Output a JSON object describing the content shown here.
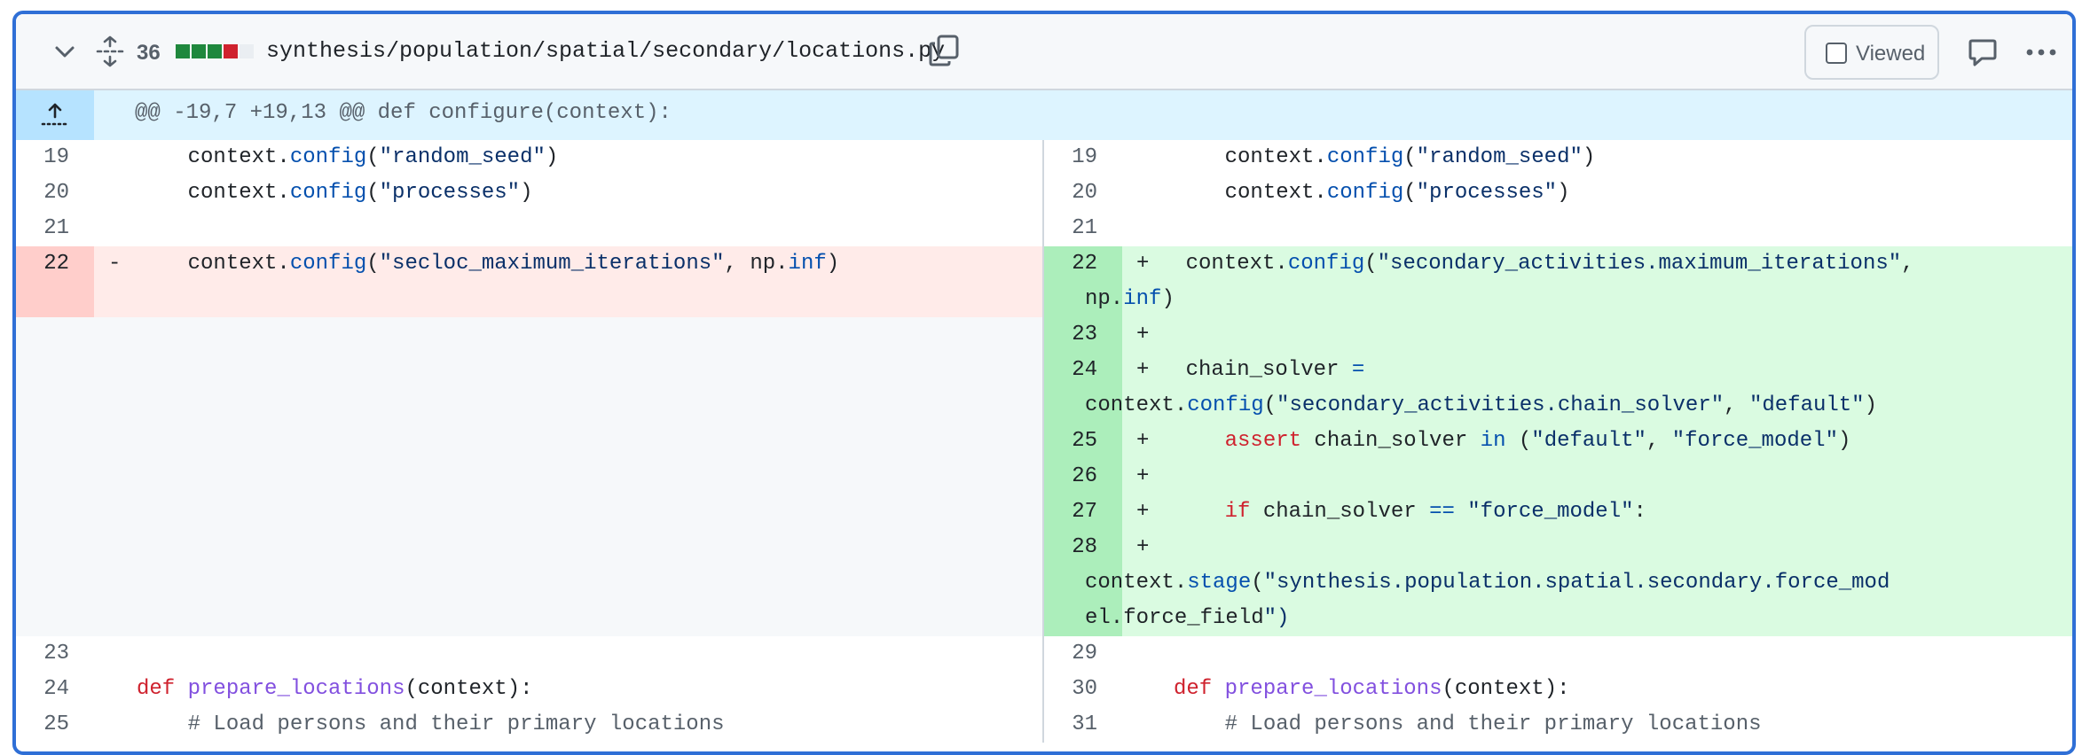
{
  "file_header": {
    "changes_count": "36",
    "diffstat_colors": [
      "#1f883d",
      "#1f883d",
      "#1f883d",
      "#cf222e",
      "#eaeef2"
    ],
    "path": "synthesis/population/spatial/secondary/locations.py",
    "viewed_label": "Viewed",
    "icons": [
      "chevron-down-icon",
      "expand-icon",
      "copy-icon",
      "comment-icon",
      "kebab-icon"
    ]
  },
  "hunk_header": "@@ -19,7 +19,13 @@ def configure(context):",
  "rows": [
    {
      "left": {
        "num": "19",
        "marker": "",
        "text": "    context.config(\"random_seed\")"
      },
      "right": {
        "num": "19",
        "marker": "",
        "text": "    context.config(\"random_seed\")"
      }
    },
    {
      "left": {
        "num": "20",
        "marker": "",
        "text": "    context.config(\"processes\")"
      },
      "right": {
        "num": "20",
        "marker": "",
        "text": "    context.config(\"processes\")"
      }
    },
    {
      "left": {
        "num": "21",
        "marker": "",
        "text": ""
      },
      "right": {
        "num": "21",
        "marker": "",
        "text": ""
      }
    },
    {
      "left": {
        "num": "22",
        "marker": "-",
        "text": "    context.config(\"secloc_maximum_iterations\", np.inf)"
      },
      "right": {
        "num": "22",
        "marker": "+",
        "text": "    context.config(\"secondary_activities.maximum_iterations\",\nnp.inf)"
      }
    },
    {
      "left": null,
      "right": {
        "num": "23",
        "marker": "+",
        "text": ""
      }
    },
    {
      "left": null,
      "right": {
        "num": "24",
        "marker": "+",
        "text": "    chain_solver =\ncontext.config(\"secondary_activities.chain_solver\", \"default\")"
      }
    },
    {
      "left": null,
      "right": {
        "num": "25",
        "marker": "+",
        "text": "    assert chain_solver in (\"default\", \"force_model\")"
      }
    },
    {
      "left": null,
      "right": {
        "num": "26",
        "marker": "+",
        "text": ""
      }
    },
    {
      "left": null,
      "right": {
        "num": "27",
        "marker": "+",
        "text": "    if chain_solver == \"force_model\":"
      }
    },
    {
      "left": null,
      "right": {
        "num": "28",
        "marker": "+",
        "text": "\ncontext.stage(\"synthesis.population.spatial.secondary.force_mod\nel.force_field\")"
      }
    },
    {
      "left": {
        "num": "23",
        "marker": "",
        "text": ""
      },
      "right": {
        "num": "29",
        "marker": "",
        "text": ""
      }
    },
    {
      "left": {
        "num": "24",
        "marker": "",
        "text": "def prepare_locations(context):"
      },
      "right": {
        "num": "30",
        "marker": "",
        "text": "def prepare_locations(context):"
      }
    },
    {
      "left": {
        "num": "25",
        "marker": "",
        "text": "    # Load persons and their primary locations"
      },
      "right": {
        "num": "31",
        "marker": "",
        "text": "    # Load persons and their primary locations"
      }
    }
  ]
}
